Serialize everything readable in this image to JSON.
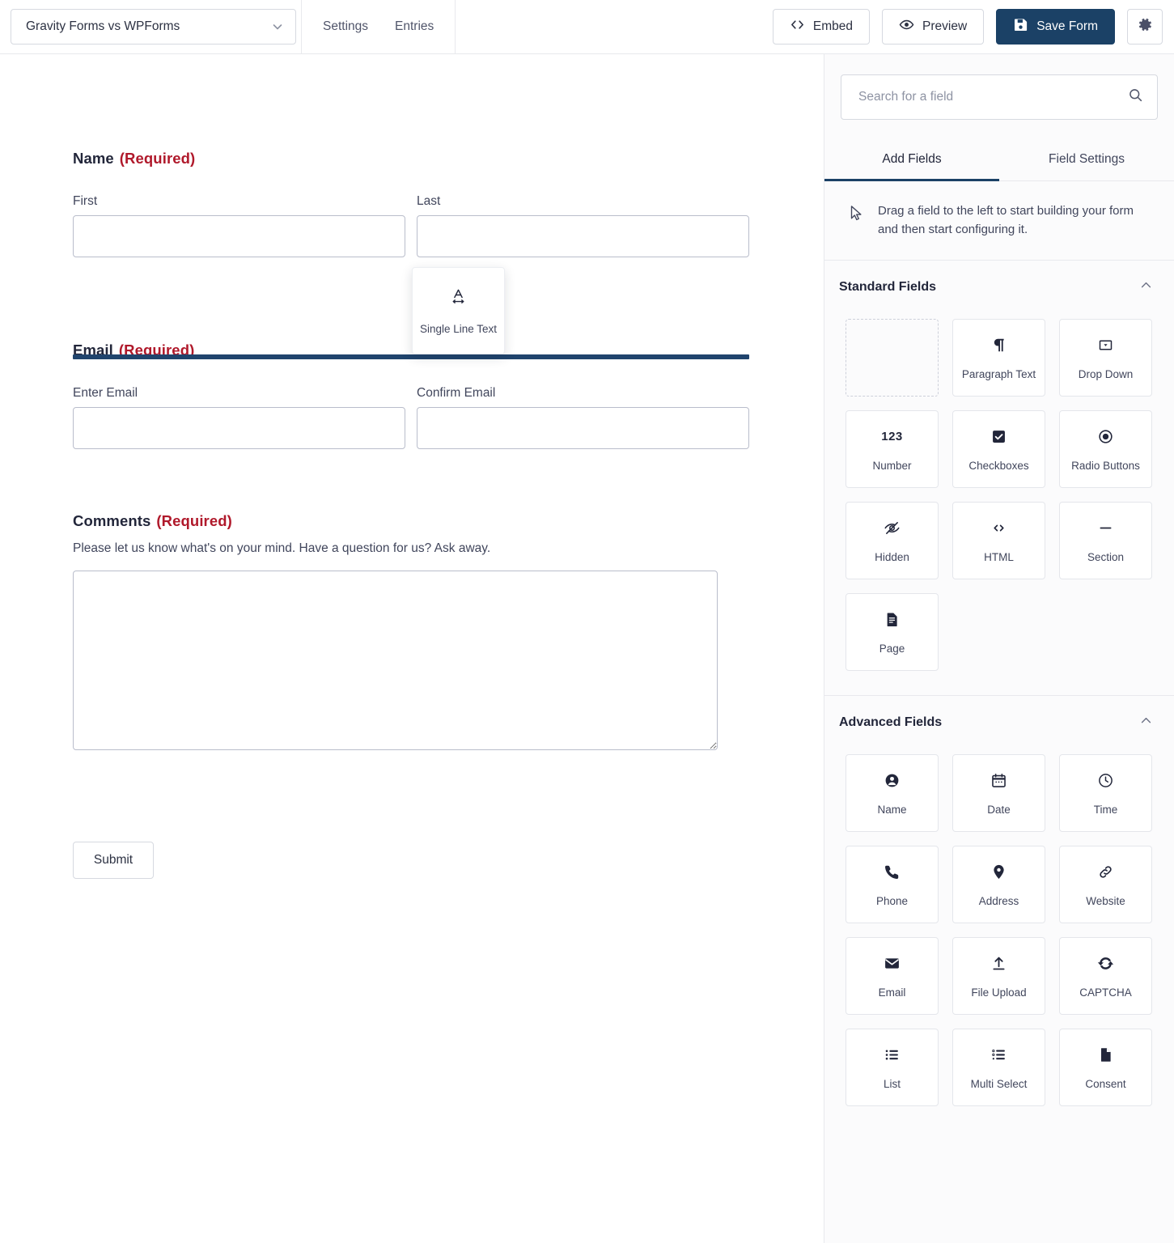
{
  "header": {
    "form_selector": {
      "title": "Gravity Forms vs WPForms",
      "chevron_icon": "chevron-down-icon"
    },
    "nav": [
      {
        "label": "Settings"
      },
      {
        "label": "Entries"
      }
    ],
    "actions": {
      "embed": {
        "label": "Embed",
        "icon": "code-icon"
      },
      "preview": {
        "label": "Preview",
        "icon": "eye-icon"
      },
      "save": {
        "label": "Save Form",
        "icon": "floppy-disk-icon",
        "color": "#1b4166"
      },
      "settings": {
        "icon": "gear-icon"
      }
    }
  },
  "form": {
    "required_suffix": "(Required)",
    "fields": [
      {
        "label": "Name",
        "required": true,
        "inputs": [
          {
            "sublabel": "First",
            "value": ""
          },
          {
            "sublabel": "Last",
            "value": ""
          }
        ]
      },
      {
        "label": "Email",
        "required": true,
        "inputs": [
          {
            "sublabel": "Enter Email",
            "value": ""
          },
          {
            "sublabel": "Confirm Email",
            "value": ""
          }
        ]
      },
      {
        "label": "Comments",
        "required": true,
        "description": "Please let us know what's on your mind. Have a question for us? Ask away.",
        "inputs": [
          {
            "sublabel": "",
            "value": ""
          }
        ]
      }
    ],
    "submit_label": "Submit"
  },
  "drag": {
    "card_label": "Single Line Text",
    "card_icon": "text-width-icon",
    "drop_indicator_color": "#20446d"
  },
  "sidebar": {
    "search": {
      "placeholder": "Search for a field",
      "value": "",
      "icon": "search-icon"
    },
    "tabs": [
      {
        "label": "Add Fields",
        "active": true
      },
      {
        "label": "Field Settings",
        "active": false
      }
    ],
    "hint": {
      "icon": "cursor-arrow-icon",
      "text": "Drag a field to the left to start building your form and then start configuring it."
    },
    "sections": [
      {
        "title": "Standard Fields",
        "caret_icon": "chevron-up-icon",
        "fields": [
          {
            "label": "",
            "icon": "empty-placeholder",
            "empty": true
          },
          {
            "label": "Paragraph Text",
            "icon": "pilcrow-icon"
          },
          {
            "label": "Drop Down",
            "icon": "dropdown-box-icon"
          },
          {
            "label": "Number",
            "icon": "number-123-icon"
          },
          {
            "label": "Checkboxes",
            "icon": "checkbox-checked-icon"
          },
          {
            "label": "Radio Buttons",
            "icon": "radio-selected-icon"
          },
          {
            "label": "Hidden",
            "icon": "eye-slash-icon"
          },
          {
            "label": "HTML",
            "icon": "angle-brackets-icon"
          },
          {
            "label": "Section",
            "icon": "minus-dash-icon"
          },
          {
            "label": "Page",
            "icon": "page-document-icon"
          }
        ]
      },
      {
        "title": "Advanced Fields",
        "caret_icon": "chevron-up-icon",
        "fields": [
          {
            "label": "Name",
            "icon": "user-circle-icon"
          },
          {
            "label": "Date",
            "icon": "calendar-icon"
          },
          {
            "label": "Time",
            "icon": "clock-icon"
          },
          {
            "label": "Phone",
            "icon": "phone-icon"
          },
          {
            "label": "Address",
            "icon": "map-pin-icon"
          },
          {
            "label": "Website",
            "icon": "link-chain-icon"
          },
          {
            "label": "Email",
            "icon": "envelope-icon"
          },
          {
            "label": "File Upload",
            "icon": "upload-arrow-icon"
          },
          {
            "label": "CAPTCHA",
            "icon": "refresh-captcha-icon"
          },
          {
            "label": "List",
            "icon": "list-bullet-icon"
          },
          {
            "label": "Multi Select",
            "icon": "multi-select-icon"
          },
          {
            "label": "Consent",
            "icon": "document-page-icon"
          }
        ]
      }
    ]
  }
}
